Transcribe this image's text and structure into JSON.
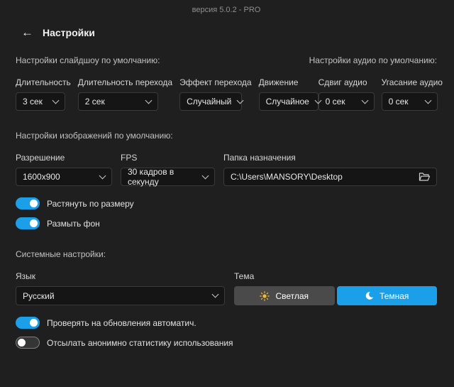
{
  "window": {
    "version_text": "версия 5.0.2 - PRO",
    "back_arrow": "←",
    "title": "Настройки"
  },
  "sections": {
    "slideshow_title": "Настройки слайдшоу по умолчанию:",
    "audio_title": "Настройки аудио по умолчанию:",
    "images_title": "Настройки изображений по умолчанию:",
    "system_title": "Системные настройки:"
  },
  "slideshow_fields": [
    {
      "label": "Длительность",
      "value": "3 сек"
    },
    {
      "label": "Длительность перехода",
      "value": "2 сек"
    },
    {
      "label": "Эффект перехода",
      "value": "Случайный"
    },
    {
      "label": "Движение",
      "value": "Случайное"
    }
  ],
  "audio_fields": [
    {
      "label": "Сдвиг аудио",
      "value": "0 сек"
    },
    {
      "label": "Угасание аудио",
      "value": "0 сек"
    }
  ],
  "image_fields": {
    "resolution": {
      "label": "Разрешение",
      "value": "1600x900"
    },
    "fps": {
      "label": "FPS",
      "value": "30 кадров в секунду"
    },
    "destination": {
      "label": "Папка назначения",
      "value": "C:\\Users\\MANSORY\\Desktop"
    }
  },
  "image_toggles": [
    {
      "label": "Растянуть по размеру",
      "on": true
    },
    {
      "label": "Размыть фон",
      "on": true
    }
  ],
  "system": {
    "language": {
      "label": "Язык",
      "value": "Русский"
    },
    "theme": {
      "label": "Тема",
      "light_label": "Светлая",
      "dark_label": "Темная",
      "selected": "dark"
    }
  },
  "system_toggles": [
    {
      "label": "Проверять на обновления автоматич.",
      "on": true
    },
    {
      "label": "Отсылать анонимно статистику использования",
      "on": false
    }
  ],
  "colors": {
    "accent": "#1a9fe8",
    "background": "#1f1f1f",
    "control_bg": "#151515"
  }
}
